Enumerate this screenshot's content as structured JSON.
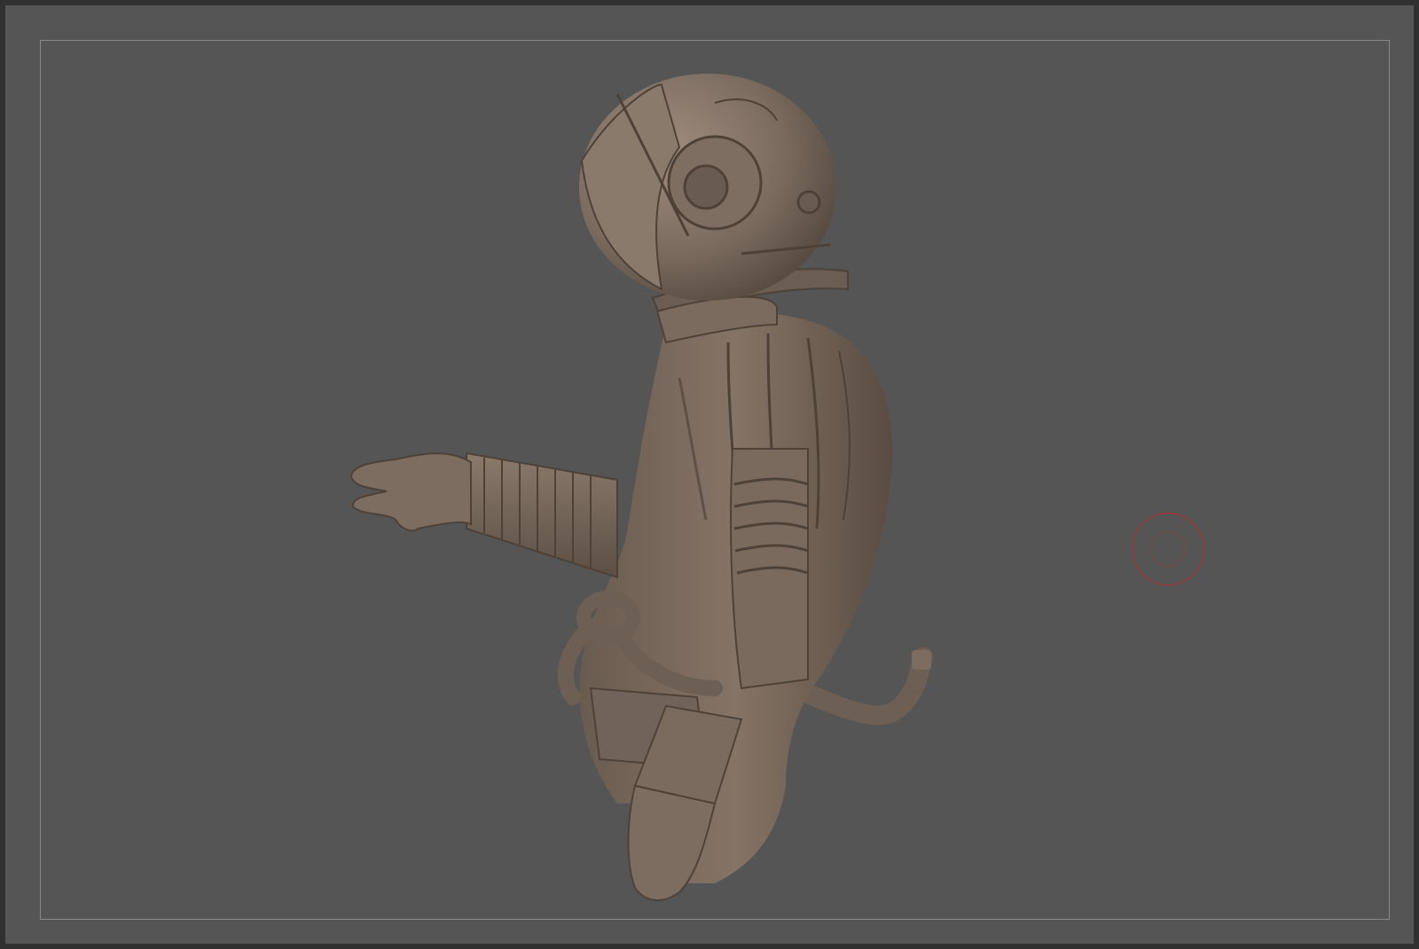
{
  "viewport": {
    "background_color": "#555555",
    "frame_color": "#303030",
    "canvas_border_color": "#8a8a8a"
  },
  "model": {
    "material_color": "#7a6a5e",
    "shadow_color": "#4e4238",
    "highlight_color": "#9a8a7c"
  },
  "brush": {
    "outer_color": "#b3302c",
    "inner_color": "#7a4a46"
  }
}
